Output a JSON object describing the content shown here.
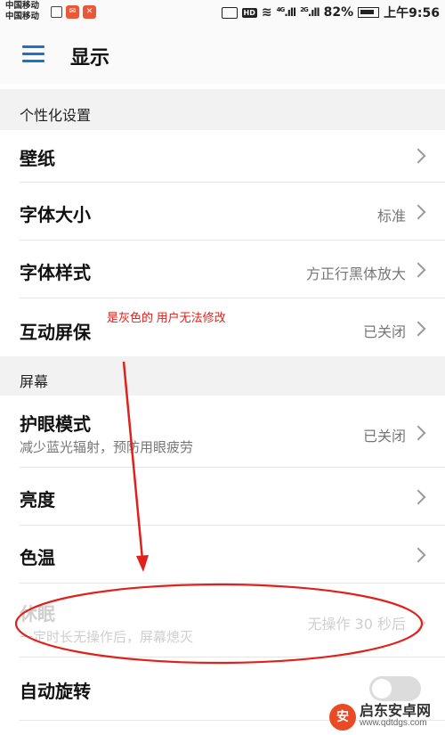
{
  "status_bar": {
    "carrier_1": "中国移动",
    "carrier_2": "中国移动",
    "network_1": "4G",
    "network_2": "2G",
    "battery": "82%",
    "time": "上午9:56"
  },
  "header": {
    "title": "显示"
  },
  "sections": {
    "personalization": {
      "title": "个性化设置",
      "wallpaper": {
        "label": "壁纸"
      },
      "font_size": {
        "label": "字体大小",
        "value": "标准"
      },
      "font_style": {
        "label": "字体样式",
        "value": "方正行黑体放大"
      },
      "interactive_screensaver": {
        "label": "互动屏保",
        "value": "已关闭"
      }
    },
    "screen": {
      "title": "屏幕",
      "eye_comfort": {
        "label": "护眼模式",
        "sub": "减少蓝光辐射，预防用眼疲劳",
        "value": "已关闭"
      },
      "brightness": {
        "label": "亮度"
      },
      "color_temp": {
        "label": "色温"
      },
      "sleep": {
        "label": "休眠",
        "sub": "一定时长无操作后，屏幕熄灭",
        "value": "无操作 30 秒后"
      },
      "auto_rotate": {
        "label": "自动旋转",
        "enabled": false
      }
    }
  },
  "annotation": {
    "text": "是灰色的 用户无法修改",
    "color": "#e0201a"
  },
  "watermark": {
    "name": "启东安卓网",
    "url": "www.qdtdgs.com"
  }
}
